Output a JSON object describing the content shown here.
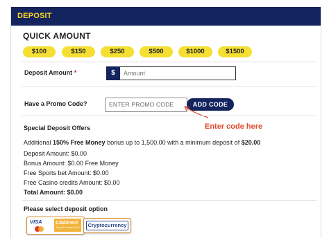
{
  "header": {
    "title": "DEPOSIT"
  },
  "quick_amount": {
    "title": "QUICK AMOUNT",
    "amounts": [
      "$100",
      "$150",
      "$250",
      "$500",
      "$1000",
      "$1500"
    ]
  },
  "deposit_amount": {
    "label": "Deposit Amount",
    "required_marker": "*",
    "currency_symbol": "$",
    "placeholder": "Amount"
  },
  "promo": {
    "label": "Have a Promo Code?",
    "placeholder": "ENTER PROMO CODE",
    "button_label": "ADD CODE",
    "annotation": "Enter code here"
  },
  "offers": {
    "title": "Special Deposit Offers",
    "line_prefix": "Additional ",
    "line_bold": "150% Free Money",
    "line_mid": " bonus up to 1,500.00 with a minimum deposit of ",
    "line_amount": "$20.00",
    "summary": [
      "Deposit Amount:  $0.00",
      "Bonus Amount:    $0.00 Free Money",
      "Free Sports bet Amount:  $0.00",
      "Free Casino credits Amount:  $0.00"
    ],
    "total": "Total Amount:  $0.00"
  },
  "payment": {
    "title": "Please select deposit option",
    "visa_label": "VISA",
    "cbdirect_label": "CBDirect",
    "cbdirect_sub": "Pay with Master Card",
    "crypto_label": "Cryptocurrency"
  },
  "colors": {
    "header_bg": "#13245e",
    "header_text": "#f5d327",
    "amount_pill": "#f5df33",
    "annotation": "#e0482b",
    "payment_border": "#d98a2b"
  }
}
